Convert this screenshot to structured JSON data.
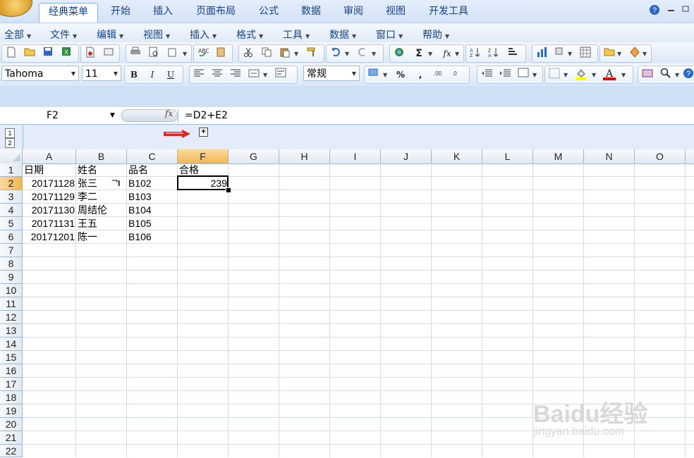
{
  "ribbon_tabs": [
    "经典菜单",
    "开始",
    "插入",
    "页面布局",
    "公式",
    "数据",
    "审阅",
    "视图",
    "开发工具"
  ],
  "menus": [
    "全部",
    "文件",
    "编辑",
    "视图",
    "插入",
    "格式",
    "工具",
    "数据",
    "窗口",
    "帮助"
  ],
  "toolbar": {
    "font_name": "Tahoma",
    "font_size": "11",
    "bold": "B",
    "italic": "I",
    "underline": "U",
    "number_format": "常规",
    "percent": "%",
    "comma": ",",
    "sum": "Σ",
    "fx": "fx",
    "font_color_label": "A",
    "accent_fill": "#ffff00",
    "accent_font": "#d40000"
  },
  "formula_bar": {
    "name_box": "F2",
    "fx_label": "fx",
    "formula": "=D2+E2"
  },
  "outline": {
    "level1": "1",
    "level2": "2",
    "expand": "+"
  },
  "columns": [
    "A",
    "B",
    "C",
    "F",
    "G",
    "H",
    "I",
    "J",
    "K",
    "L",
    "M",
    "N",
    "O"
  ],
  "selected_column": "F",
  "rows": [
    "1",
    "2",
    "3",
    "4",
    "5",
    "6",
    "7",
    "8",
    "9",
    "10",
    "11",
    "12",
    "13",
    "14",
    "15",
    "16",
    "17",
    "18",
    "19",
    "20",
    "21",
    "22"
  ],
  "selected_row": "2",
  "sheet": {
    "headers": {
      "A": "日期",
      "B": "姓名",
      "C": "品名",
      "F": "合格"
    },
    "data": [
      {
        "A": "20171128",
        "B": "张三",
        "C": "B102",
        "F": "239"
      },
      {
        "A": "20171129",
        "B": "李二",
        "C": "B103",
        "F": ""
      },
      {
        "A": "20171130",
        "B": "周结伦",
        "C": "B104",
        "F": ""
      },
      {
        "A": "20171131",
        "B": "王五",
        "C": "B105",
        "F": ""
      },
      {
        "A": "20171201",
        "B": "陈一",
        "C": "B106",
        "F": ""
      }
    ]
  },
  "watermark": {
    "line1": "Baidu经验",
    "line2": "jingyan.baidu.com"
  }
}
